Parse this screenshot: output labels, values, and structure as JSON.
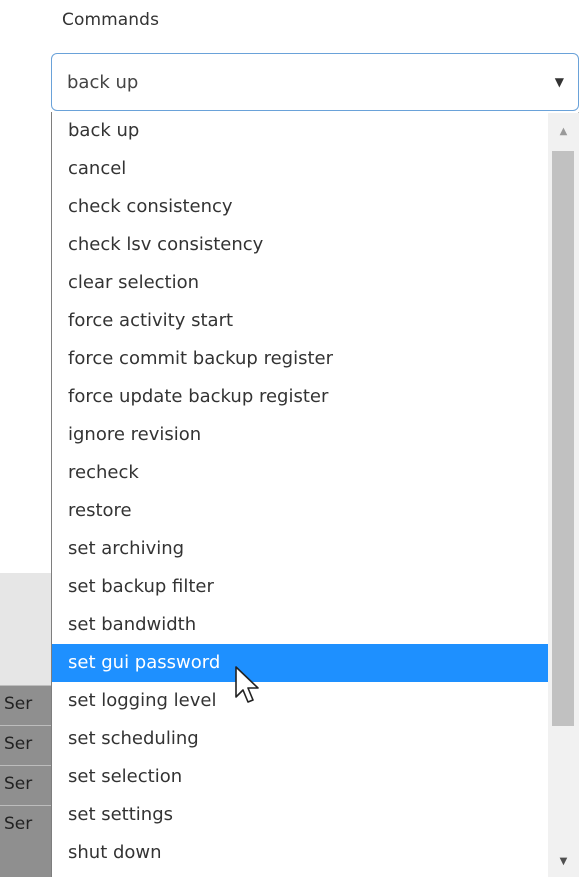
{
  "commands_label": "Commands",
  "select": {
    "selected_value": "back up",
    "arrow_glyph": "▼"
  },
  "options": [
    "back up",
    "cancel",
    "check consistency",
    "check lsv consistency",
    "clear selection",
    "force activity start",
    "force commit backup register",
    "force update backup register",
    "ignore revision",
    "recheck",
    "restore",
    "set archiving",
    "set backup filter",
    "set bandwidth",
    "set gui password",
    "set logging level",
    "set scheduling",
    "set selection",
    "set settings",
    "shut down"
  ],
  "highlighted_option": "set gui password",
  "background_rows": [
    "Ser",
    "Ser",
    "Ser",
    "Ser"
  ],
  "scrollbar": {
    "up_glyph": "▲",
    "down_glyph": "▼"
  },
  "colors": {
    "highlight": "#1e90ff",
    "select_border": "#6aa2d9",
    "scroll_thumb": "#c1c1c1"
  },
  "icons": {
    "dropdown_arrow": "chevron-down-icon",
    "cursor": "mouse-pointer-icon"
  }
}
